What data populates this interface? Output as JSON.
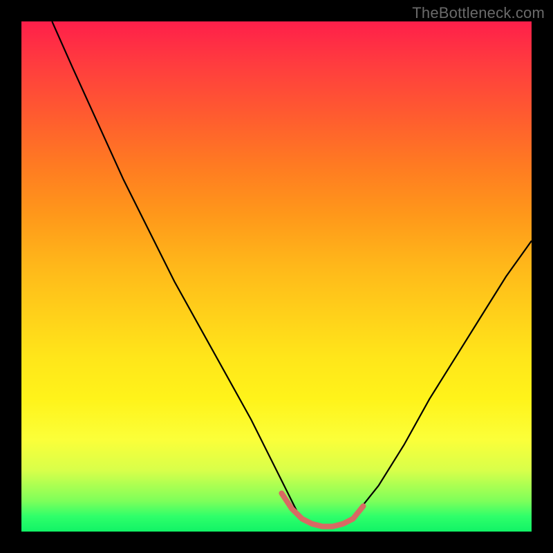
{
  "watermark": "TheBottleneck.com",
  "chart_data": {
    "type": "line",
    "title": "",
    "xlabel": "",
    "ylabel": "",
    "xlim": [
      0,
      100
    ],
    "ylim": [
      0,
      100
    ],
    "series": [
      {
        "name": "curve",
        "color": "#000000",
        "x": [
          6,
          10,
          15,
          20,
          25,
          30,
          35,
          40,
          45,
          50,
          52,
          54,
          56,
          58,
          60,
          62,
          64,
          66,
          70,
          75,
          80,
          85,
          90,
          95,
          100
        ],
        "y": [
          100,
          91,
          80,
          69,
          59,
          49,
          40,
          31,
          22,
          12,
          8,
          4,
          2,
          1,
          1,
          1,
          2,
          4,
          9,
          17,
          26,
          34,
          42,
          50,
          57
        ]
      }
    ],
    "trough_marker": {
      "color": "#d86a63",
      "width": 8,
      "x": [
        51,
        53,
        55,
        57,
        59,
        61,
        63,
        65,
        67
      ],
      "y": [
        7.5,
        4.5,
        2.5,
        1.5,
        1.0,
        1.0,
        1.5,
        2.5,
        5.0
      ]
    }
  }
}
